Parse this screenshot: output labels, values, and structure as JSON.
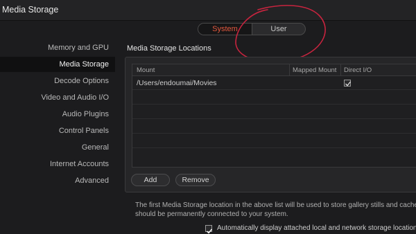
{
  "window": {
    "title": "Media Storage"
  },
  "segmented": {
    "options": [
      "System",
      "User"
    ],
    "selected": "System"
  },
  "sidebar": {
    "items": [
      {
        "label": "Memory and GPU"
      },
      {
        "label": "Media Storage",
        "active": true
      },
      {
        "label": "Decode Options"
      },
      {
        "label": "Video and Audio I/O"
      },
      {
        "label": "Audio Plugins"
      },
      {
        "label": "Control Panels"
      },
      {
        "label": "General"
      },
      {
        "label": "Internet Accounts"
      },
      {
        "label": "Advanced"
      }
    ]
  },
  "main": {
    "section_title": "Media Storage Locations",
    "table": {
      "columns": [
        "Mount",
        "Mapped Mount",
        "Direct I/O"
      ],
      "rows": [
        {
          "mount": "/Users/endoumai/Movies",
          "mapped": "",
          "direct_io": true
        }
      ]
    },
    "buttons": {
      "add": "Add",
      "remove": "Remove"
    },
    "note_line1": "The first Media Storage location in the above list will be used to store gallery stills and cache f",
    "note_line2": "should be permanently connected to your system.",
    "auto_display": {
      "checked": true,
      "label": "Automatically display attached local and network storage location"
    }
  },
  "colors": {
    "accent": "#e2583e",
    "annotation": "#c8243f",
    "background": "#1c1c1e"
  }
}
